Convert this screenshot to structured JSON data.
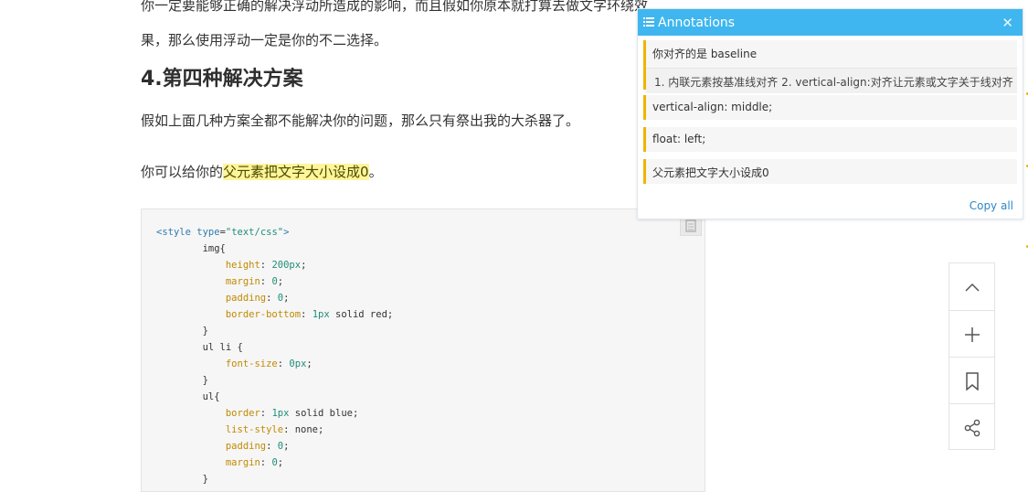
{
  "article": {
    "top_line": "你一定要能够正确的解决浮动所造成的影响，而且假如你原本就打算去做文字环绕效",
    "line2": "果，那么使用浮动一定是你的不二选择。",
    "heading": "4.第四种解决方案",
    "para1": "假如上面几种方案全都不能解决你的问题，那么只有祭出我的大杀器了。",
    "para2_prefix": "你可以给你的",
    "para2_highlight": "父元素把文字大小设成0",
    "para2_suffix": "。"
  },
  "code": {
    "lines": [
      "<style type=\"text/css\">",
      "        img{",
      "            height: 200px;",
      "            margin: 0;",
      "            padding: 0;",
      "            border-bottom: 1px solid red;",
      "        }",
      "        ul li {",
      "            font-size: 0px;",
      "        }",
      "        ul{",
      "            border: 1px solid blue;",
      "            list-style: none;",
      "            padding: 0;",
      "            margin: 0;",
      "        }"
    ]
  },
  "panel": {
    "title": "Annotations",
    "close": "✕",
    "items": [
      {
        "text": "你对齐的是 baseline",
        "note": "1. 内联元素按基准线对齐 2. vertical-align:对齐让元素或文字关于线对齐"
      },
      {
        "text": "vertical-align: middle;"
      },
      {
        "text": "float: left;"
      },
      {
        "text": "父元素把文字大小设成0"
      }
    ],
    "copy_all": "Copy all"
  },
  "tools": [
    "chevron-up-icon",
    "plus-icon",
    "bookmark-icon",
    "share-icon"
  ],
  "colors": {
    "accent": "#3fb6ef",
    "annotation_bar": "#f0b400",
    "highlight": "#fff59a"
  }
}
